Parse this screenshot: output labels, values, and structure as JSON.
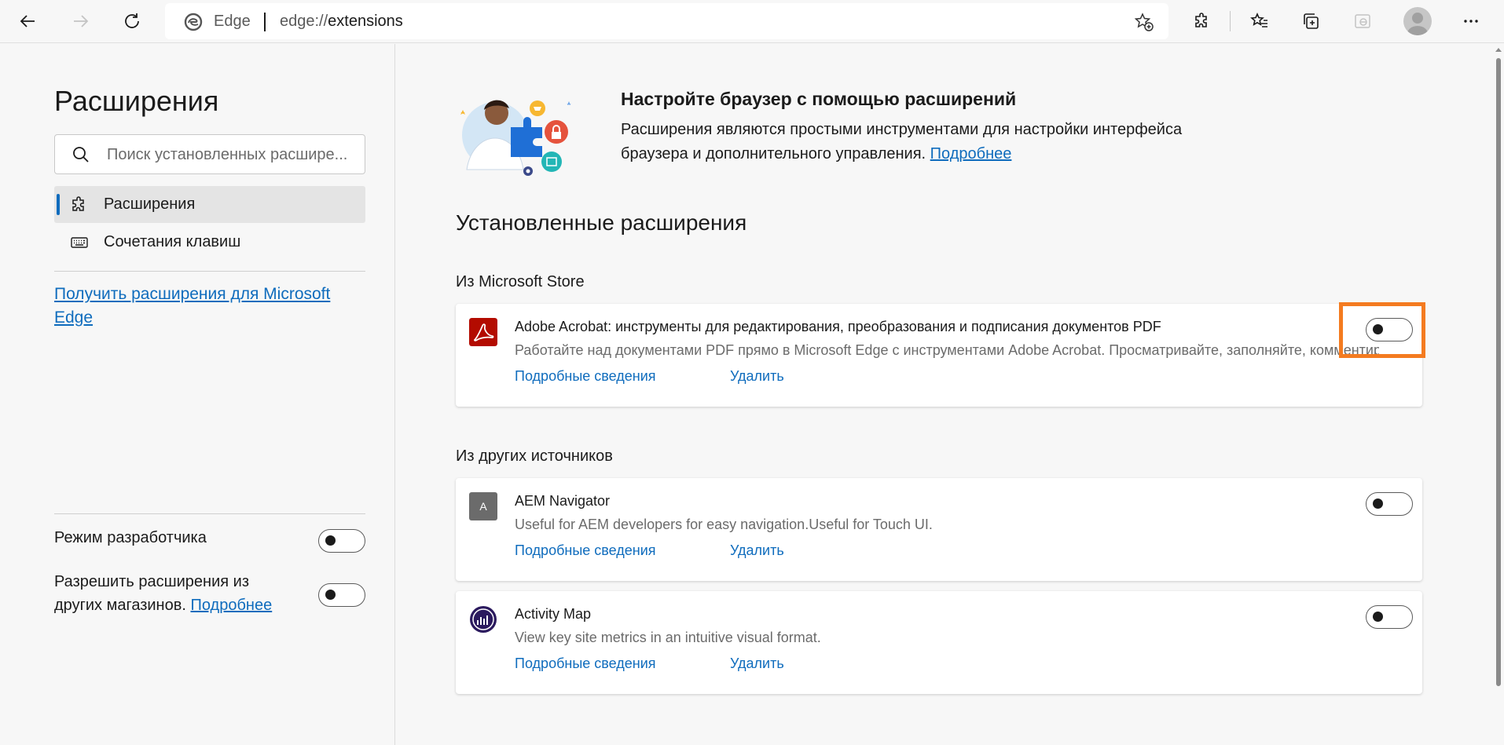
{
  "toolbar": {
    "back_icon": "arrow-left-icon",
    "forward_icon": "arrow-right-icon",
    "refresh_icon": "refresh-icon",
    "address": {
      "site_label": "Edge",
      "url_scheme": "edge://",
      "url_path": "extensions"
    },
    "icons": [
      "add-favorite-icon",
      "extensions-icon",
      "favorites-icon",
      "collections-icon",
      "ie-mode-icon",
      "profile-avatar",
      "more-icon"
    ]
  },
  "sidebar": {
    "title": "Расширения",
    "search_placeholder": "Поиск установленных расшире...",
    "nav": [
      {
        "label": "Расширения",
        "icon": "gear-icon",
        "active": true
      },
      {
        "label": "Сочетания клавиш",
        "icon": "keyboard-icon",
        "active": false
      }
    ],
    "get_extensions_link": "Получить расширения для Microsoft Edge",
    "developer_mode_label": "Режим разработчика",
    "developer_mode_on": false,
    "other_stores_label": "Разрешить расширения из других магазинов.",
    "other_stores_link": "Подробнее",
    "other_stores_on": false
  },
  "main": {
    "hero": {
      "title": "Настройте браузер с помощью расширений",
      "description_line1": "Расширения являются простыми инструментами для настройки интерфейса",
      "description_line2": "браузера и дополнительного управления.",
      "learn_more": "Подробнее"
    },
    "installed_title": "Установленные расширения",
    "groups": [
      {
        "title": "Из Microsoft Store",
        "extensions": [
          {
            "name": "Adobe Acrobat: инструменты для редактирования, преобразования и подписания документов PDF",
            "description": "Работайте над документами PDF прямо в Microsoft Edge с инструментами Adobe Acrobat. Просматривайте, заполняйте, комментируйте",
            "details_link": "Подробные сведения",
            "remove_link": "Удалить",
            "enabled": false,
            "icon_color": "#b30b00",
            "highlighted": true
          }
        ]
      },
      {
        "title": "Из других источников",
        "extensions": [
          {
            "name": "AEM Navigator",
            "description": "Useful for AEM developers for easy navigation.Useful for Touch UI.",
            "details_link": "Подробные сведения",
            "remove_link": "Удалить",
            "enabled": false,
            "icon_letter": "A",
            "icon_color": "#6b6b6b"
          },
          {
            "name": "Activity Map",
            "description": "View key site metrics in an intuitive visual format.",
            "details_link": "Подробные сведения",
            "remove_link": "Удалить",
            "enabled": false,
            "icon_color": "#2b1a5e"
          }
        ]
      }
    ]
  },
  "colors": {
    "accent": "#0f6cbd",
    "highlight": "#f47b20"
  }
}
